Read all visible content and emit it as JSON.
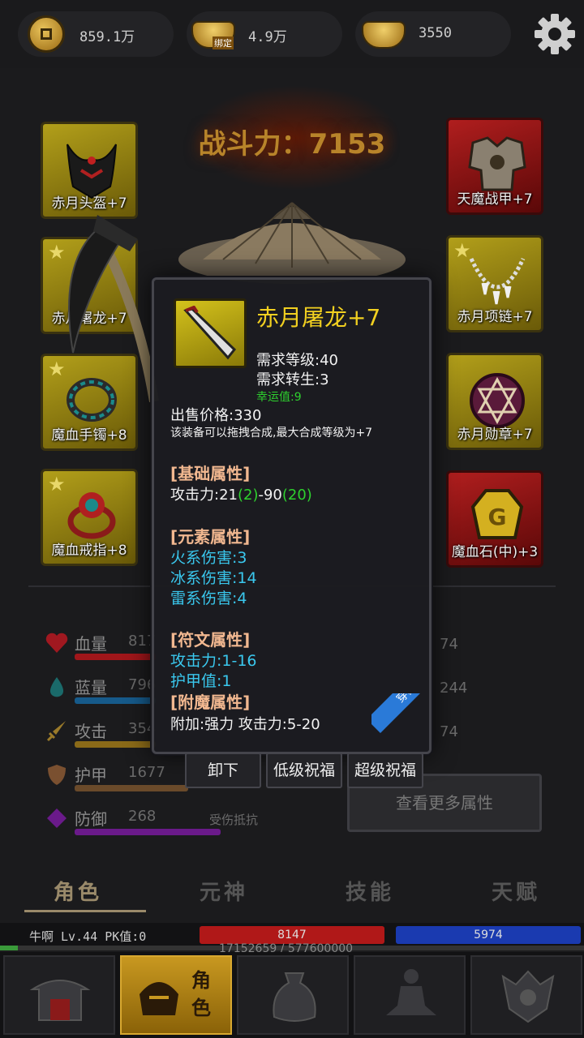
{
  "currencies": [
    {
      "icon": "copper-coin-icon",
      "value": "859.1万"
    },
    {
      "icon": "bound-gold-ingot-icon",
      "value": "4.9万",
      "tag": "绑定"
    },
    {
      "icon": "gold-ingot-icon",
      "value": "3550"
    }
  ],
  "power": {
    "label": "战斗力：7153"
  },
  "equipment": {
    "left": [
      {
        "label": "赤月头盔+7",
        "starred": false,
        "color": "gold"
      },
      {
        "label": "赤月屠龙+7",
        "starred": true,
        "color": "gold"
      },
      {
        "label": "魔血手镯+8",
        "starred": true,
        "color": "gold"
      },
      {
        "label": "魔血戒指+8",
        "starred": true,
        "color": "gold"
      }
    ],
    "right": [
      {
        "label": "天魔战甲+7",
        "starred": false,
        "color": "red"
      },
      {
        "label": "赤月项链+7",
        "starred": true,
        "color": "gold"
      },
      {
        "label": "赤月勋章+7",
        "starred": false,
        "color": "gold"
      },
      {
        "label": "魔血石(中)+3",
        "starred": false,
        "color": "red"
      }
    ]
  },
  "stats": [
    {
      "icon": "heart-icon",
      "label": "血量",
      "value": "817",
      "color": "#a0161a",
      "right": "74"
    },
    {
      "icon": "mana-drop-icon",
      "label": "蓝量",
      "value": "796",
      "color": "#165a8a",
      "right": "244"
    },
    {
      "icon": "sword-icon",
      "label": "攻击",
      "value": "354",
      "color": "#8a6a18",
      "right": "74"
    },
    {
      "icon": "shield-icon",
      "label": "护甲",
      "value": "1677",
      "color": "#6a4a2a"
    },
    {
      "icon": "defense-icon",
      "label": "防御",
      "value": "268",
      "color": "#6a1a8a",
      "extra": "受伤抵抗"
    }
  ],
  "more_button": "查看更多属性",
  "tabs": [
    "角色",
    "元神",
    "技能",
    "天赋"
  ],
  "player": {
    "info": "牛啊  Lv.44 PK值:0",
    "hp": "8147",
    "mp": "5974",
    "exp": "17152659 / 577600000"
  },
  "nav": [
    "home-gate-icon",
    "character-helmet-icon",
    "bag-icon",
    "meditation-icon",
    "taoist-icon"
  ],
  "nav_active_text": "角\n色",
  "tooltip": {
    "name": "赤月屠龙+7",
    "req_level": "需求等级:40",
    "req_rebirth": "需求转生:3",
    "luck": "幸运值:9",
    "price": "出售价格:330",
    "merge_note": "该装备可以拖拽合成,最大合成等级为+7",
    "base_title": "[基础属性]",
    "attack_prefix": "攻击力:21",
    "attack_b1": "(2)",
    "attack_mid": "-90",
    "attack_b2": "(20)",
    "element_title": "[元素属性]",
    "fire": "火系伤害:3",
    "ice": "冰系伤害:14",
    "thunder": "雷系伤害:4",
    "rune_title": "[符文属性]",
    "rune_attack": "攻击力:1-16",
    "rune_armor": "护甲值:1",
    "enchant_title": "[附魔属性]",
    "enchant": "附加:强力 攻击力:5-20",
    "equipped": "穿戴中",
    "buttons": [
      "卸下",
      "低级祝福",
      "超级祝福"
    ]
  }
}
